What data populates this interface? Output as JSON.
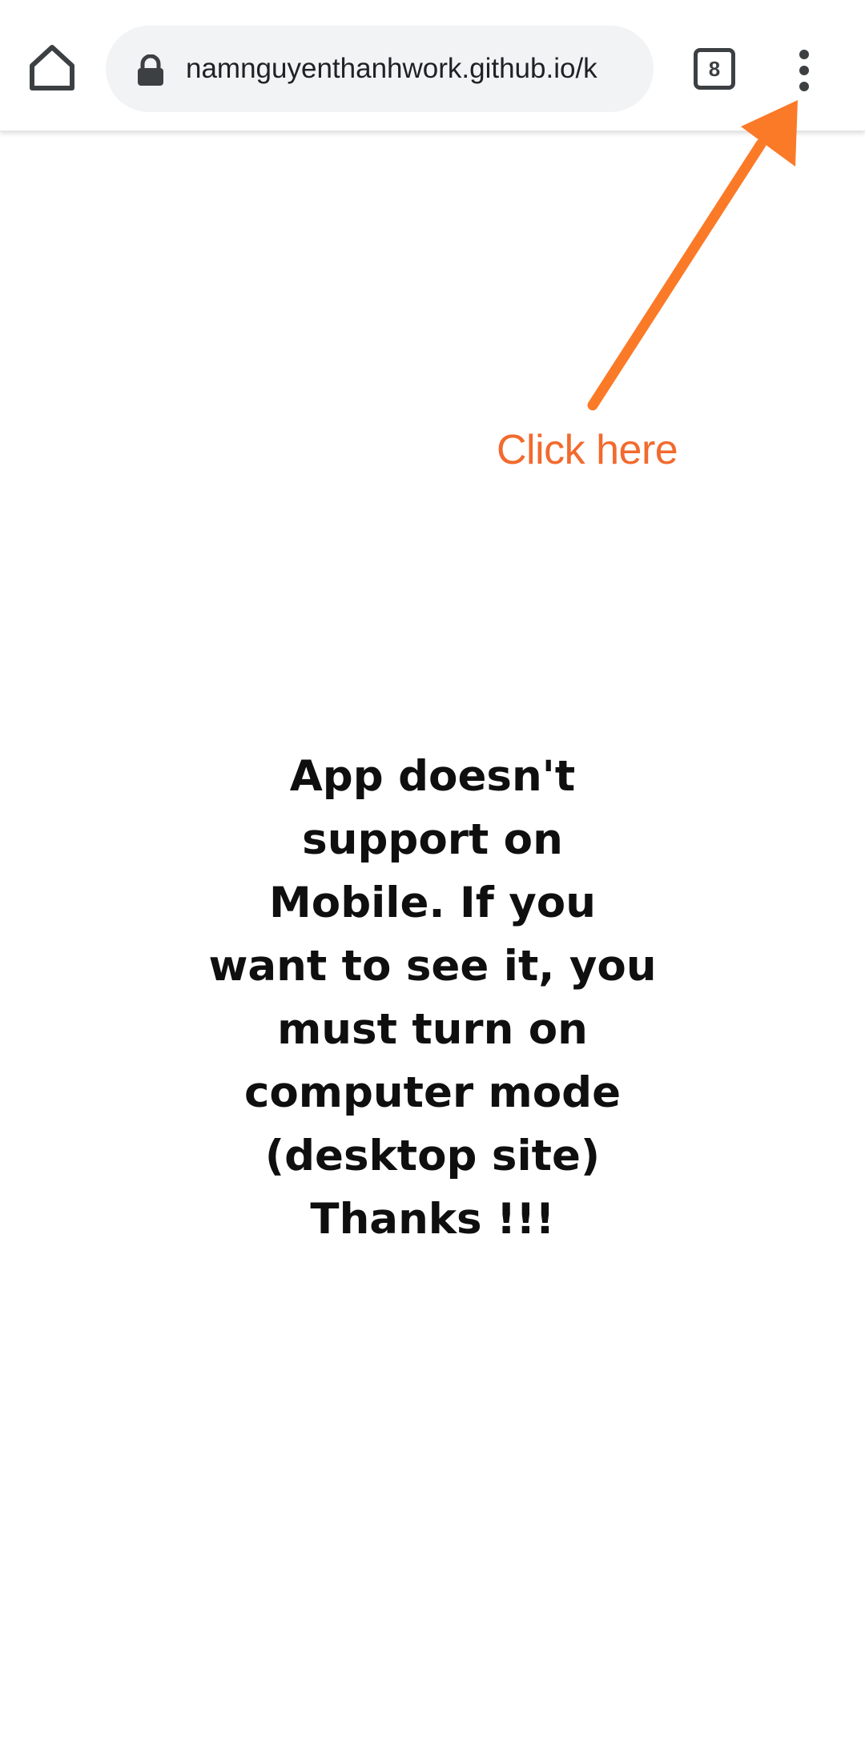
{
  "browser": {
    "url": "namnguyenthanhwork.github.io/k",
    "tab_count": "8",
    "icons": {
      "home": "home-icon",
      "lock": "lock-icon",
      "tabs": "tab-switcher-icon",
      "menu": "more-vert-icon"
    }
  },
  "annotation": {
    "label": "Click here",
    "color": "#f26a2e",
    "arrow_color": "#fb7a28"
  },
  "page": {
    "message_lines": [
      "App doesn't",
      "support on",
      "Mobile. If you",
      "want to see it, you",
      "must turn on",
      "computer mode",
      "(desktop site)",
      "Thanks !!!"
    ]
  }
}
